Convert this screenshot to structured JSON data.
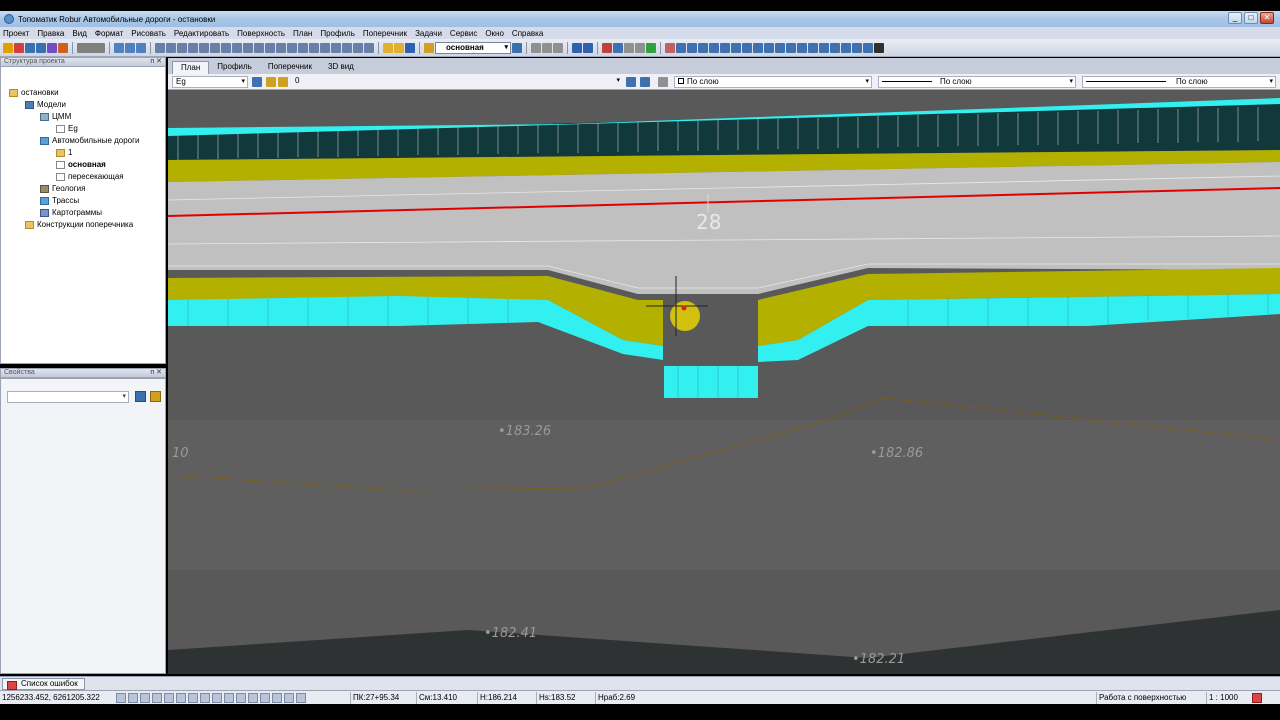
{
  "window": {
    "title": "Топоматик Robur Автомобильные дороги - остановки",
    "buttons": {
      "minimize": "_",
      "maximize": "□",
      "close": "✕"
    }
  },
  "menu": [
    "Проект",
    "Правка",
    "Вид",
    "Формат",
    "Рисовать",
    "Редактировать",
    "Поверхность",
    "План",
    "Профиль",
    "Поперечник",
    "Задачи",
    "Сервис",
    "Окно",
    "Справка"
  ],
  "toolbar": {
    "layer_dropdown": "основная"
  },
  "project_panel": {
    "title": "Структура проекта",
    "controls": "ᴨ ✕",
    "tree": [
      {
        "label": "остановки",
        "icon": "folder"
      },
      {
        "label": "Модели",
        "icon": "model"
      },
      {
        "label": "ЦММ",
        "icon": "grid"
      },
      {
        "label": "Eg",
        "icon": "doc"
      },
      {
        "label": "Автомобильные дороги",
        "icon": "road"
      },
      {
        "label": "1",
        "icon": "folder"
      },
      {
        "label": "основная",
        "icon": "doc",
        "selected": true
      },
      {
        "label": "пересекающая",
        "icon": "doc"
      },
      {
        "label": "Геология",
        "icon": "geo"
      },
      {
        "label": "Трассы",
        "icon": "road"
      },
      {
        "label": "Картограммы",
        "icon": "cart"
      },
      {
        "label": "Конструкции поперечника",
        "icon": "folder"
      }
    ]
  },
  "properties_panel": {
    "title": "Свойства",
    "controls": "ᴨ ✕",
    "select_value": ""
  },
  "tabs": [
    "План",
    "Профиль",
    "Поперечник",
    "3D вид"
  ],
  "active_tab": "План",
  "layerbar": {
    "surface": "Eg",
    "layer_value": "0",
    "color": "По слою",
    "linetype": "По слою",
    "lineweight": "По слою"
  },
  "canvas": {
    "station_label": "28",
    "elevations": [
      "•183.26",
      "•182.86",
      "•182.41",
      "•182.21",
      "10"
    ]
  },
  "errors_tab": "Список ошибок",
  "status": {
    "coords": "1256233.452, 6261205.322",
    "pk": "ПК:27+95.34",
    "offset": "См:13.410",
    "h": "Н:186.214",
    "hs": "Нs:183.52",
    "hrab": "Нраб:2.69",
    "mode": "Работа с поверхностью",
    "scale": "1 : 1000"
  },
  "colors": {
    "canvas_bg": "#595959",
    "road_surface": "#c0c0c0",
    "shoulder": "#b4b000",
    "slope_cyan": "#33f0f0",
    "fence_dark": "#11393b",
    "axis_red": "#e00000",
    "cursor_yellow": "#e6d200"
  }
}
